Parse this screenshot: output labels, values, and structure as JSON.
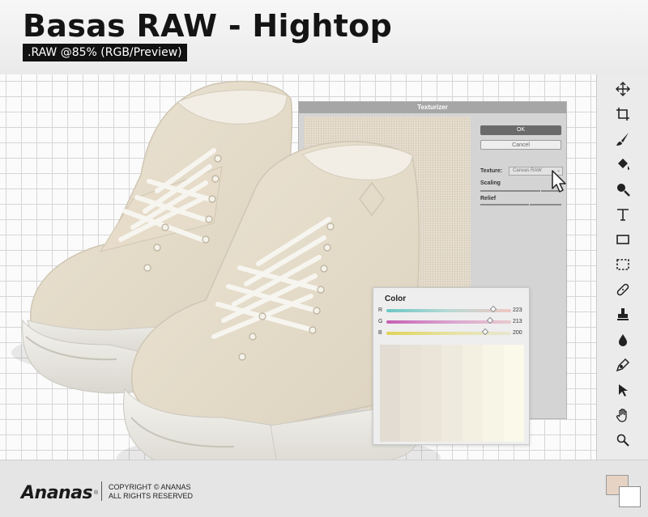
{
  "header": {
    "title": "Basas RAW - Hightop",
    "subtitle": ".RAW @85% (RGB/Preview)"
  },
  "texturizer": {
    "title": "Texturizer",
    "ok_label": "OK",
    "cancel_label": "Cancel",
    "texture_label": "Texture:",
    "texture_value": "Canvas RAW",
    "scaling_label": "Scaling",
    "relief_label": "Relief"
  },
  "color_panel": {
    "title": "Color",
    "channels": [
      {
        "label": "R",
        "value": "223",
        "level": 0.86
      },
      {
        "label": "G",
        "value": "213",
        "level": 0.83
      },
      {
        "label": "B",
        "value": "200",
        "level": 0.79
      }
    ],
    "swatches": [
      "#e2dcd3",
      "#e7e1d6",
      "#ebe5d9",
      "#eeeadd",
      "#f3f0e2",
      "#f6f5e6",
      "#faf9ea"
    ]
  },
  "tools": [
    "move-icon",
    "crop-icon",
    "brush-icon",
    "paint-bucket-icon",
    "zoom-magnifier-icon",
    "type-icon",
    "rectangle-icon",
    "marquee-select-icon",
    "healing-bandage-icon",
    "stamp-icon",
    "drop-icon",
    "pen-icon",
    "pointer-icon",
    "hand-icon",
    "zoom-icon"
  ],
  "colors": {
    "foreground": "#e6d3c4",
    "background": "#ffffff",
    "canvas_grid": "#d6d6d6"
  },
  "footer": {
    "brand": "Ananas",
    "registered": "®",
    "copyright_line1": "COPYRIGHT © ANANAS",
    "copyright_line2": "ALL RIGHTS RESERVED"
  }
}
